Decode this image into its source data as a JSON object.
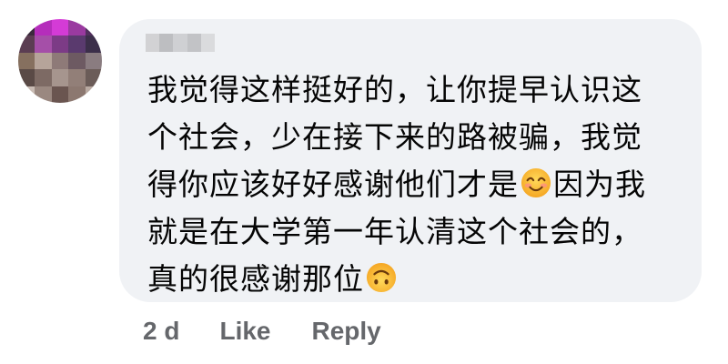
{
  "comment": {
    "avatar_colors": [
      "#3a2a3c",
      "#b52dbb",
      "#d43bd6",
      "#9a3aa0",
      "#52305e",
      "#5b3d52",
      "#a54fa8",
      "#7c3b86",
      "#5a3a6e",
      "#3c2f4a",
      "#86705f",
      "#b6a49a",
      "#8e7a78",
      "#6d5a62",
      "#8a7c80",
      "#5a4a46",
      "#7d6a64",
      "#a6958e",
      "#927f78",
      "#6b5c58",
      "#c9bcb4",
      "#9a8880",
      "#6a5550",
      "#8c7870",
      "#b9aaa2"
    ],
    "author_name_blocks": [
      "#d2d2d4",
      "#bdbec1",
      "#cfd0d3",
      "#c2c3c6",
      "#dadbdd"
    ],
    "text_lines": [
      "我觉得这样挺好的，让你提早认识这",
      "个社会，少在接下来的路被骗，我觉",
      "得你应该好好感谢他们才是",
      "因为我",
      "就是在大学第一年认清这个社会的，",
      "真的很感谢那位"
    ],
    "emojis": {
      "smile": "smiling-face-with-smiling-eyes",
      "upside_down": "upside-down-face"
    },
    "colors": {
      "bubble_bg": "#f0f2f5",
      "text": "#050505",
      "meta": "#65676b"
    }
  },
  "actions": {
    "timestamp": "2 d",
    "like_label": "Like",
    "reply_label": "Reply"
  }
}
